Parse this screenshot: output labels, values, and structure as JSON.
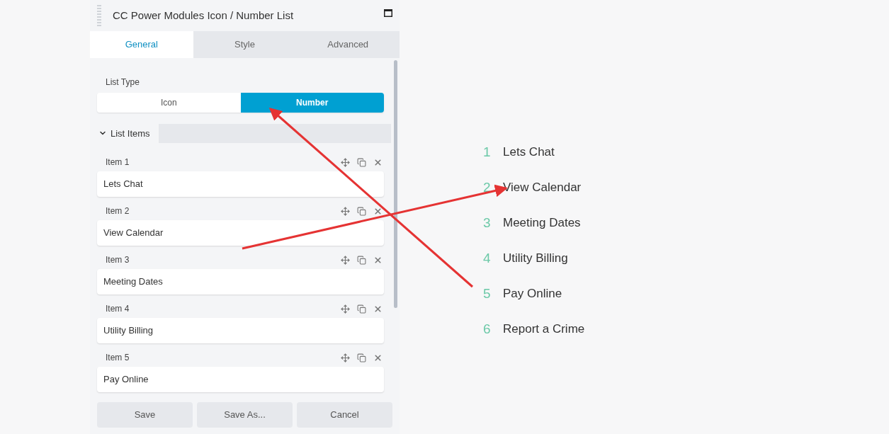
{
  "panel": {
    "title": "CC Power Modules Icon / Number List",
    "tabs": [
      {
        "label": "General",
        "selected": true
      },
      {
        "label": "Style",
        "selected": false
      },
      {
        "label": "Advanced",
        "selected": false
      }
    ],
    "list_type": {
      "label": "List Type",
      "options": [
        {
          "label": "Icon",
          "selected": false
        },
        {
          "label": "Number",
          "selected": true
        }
      ]
    },
    "list_items": {
      "title": "List Items",
      "expanded": true,
      "items": [
        {
          "label": "Item 1",
          "value": "Lets Chat"
        },
        {
          "label": "Item 2",
          "value": "View Calendar"
        },
        {
          "label": "Item 3",
          "value": "Meeting Dates"
        },
        {
          "label": "Item 4",
          "value": "Utility Billing"
        },
        {
          "label": "Item 5",
          "value": "Pay Online"
        }
      ]
    },
    "buttons": [
      "Save",
      "Save As...",
      "Cancel"
    ]
  },
  "preview": {
    "items": [
      {
        "number": "1",
        "text": "Lets Chat"
      },
      {
        "number": "2",
        "text": "View Calendar"
      },
      {
        "number": "3",
        "text": "Meeting Dates"
      },
      {
        "number": "4",
        "text": "Utility Billing"
      },
      {
        "number": "5",
        "text": "Pay Online"
      },
      {
        "number": "6",
        "text": "Report a Crime"
      }
    ]
  }
}
